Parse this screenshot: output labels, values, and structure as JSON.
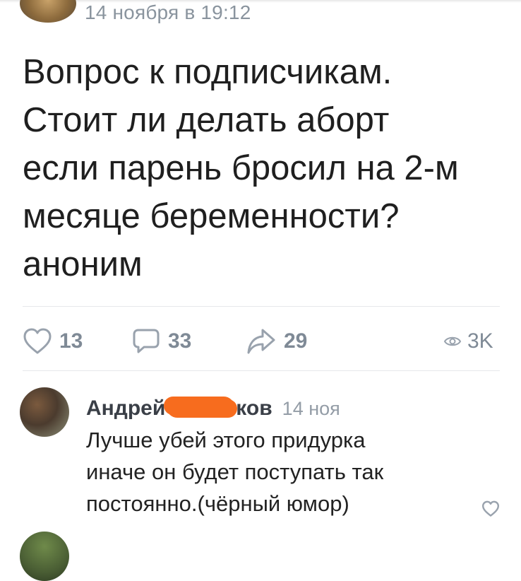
{
  "post": {
    "date": "14 ноября в 19:12",
    "text": "Вопрос к подписчикам.\nСтоит ли делать аборт\nесли парень бросил на 2-м\nмесяце беременности?\nаноним"
  },
  "actions": {
    "likes": "13",
    "comments": "33",
    "reposts": "29",
    "views": "3K"
  },
  "comment": {
    "author_first": "Андрей",
    "author_last_visible": "ков",
    "time": "14 ноя",
    "text": "Лучше убей этого придурка\nиначе он будет поступать так\nпостоянно.(чёрный юмор)"
  },
  "icons": {
    "like": "heart-icon",
    "comment": "speech-bubble-icon",
    "repost": "share-arrow-icon",
    "views": "eye-icon",
    "comment_like": "heart-icon"
  },
  "colors": {
    "meta_gray": "#818c99",
    "redaction": "#f76c1e"
  }
}
